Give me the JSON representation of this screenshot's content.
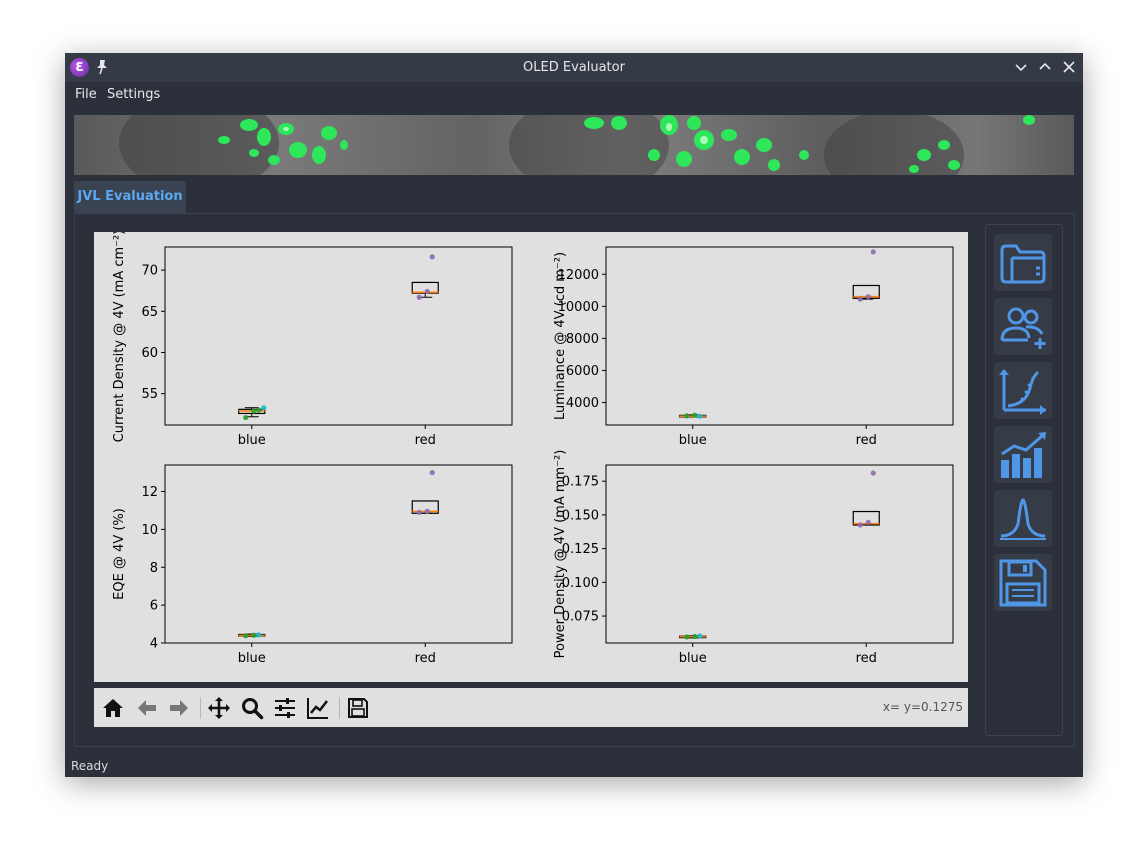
{
  "window": {
    "title": "OLED Evaluator",
    "app_icon_letter": "Ɛ"
  },
  "menu": [
    "File",
    "Settings"
  ],
  "tabs": [
    {
      "label": "JVL Evaluation"
    }
  ],
  "toolbar": {
    "icons": [
      "home-icon",
      "back-icon",
      "forward-icon",
      "pan-icon",
      "zoom-icon",
      "configure-subplots-icon",
      "edit-axis-icon",
      "save-figure-icon"
    ],
    "coords": "x= y=0.1275"
  },
  "side_buttons": [
    "open-folder-icon",
    "add-users-icon",
    "fit-curve-icon",
    "statistics-chart-icon",
    "spectrum-icon",
    "save-icon"
  ],
  "status": "Ready",
  "colors": {
    "accent": "#4f97e6",
    "median": "#ff7f0e",
    "blue_group": "#2ca02c",
    "blue_group_alt": "#17becf",
    "red_group": "#8c6bb1"
  },
  "chart_data": [
    {
      "type": "box",
      "ylabel": "Current Density @ 4V (mA cm⁻²)",
      "categories": [
        "blue",
        "red"
      ],
      "ylim": [
        51.2,
        72.8
      ],
      "yticks": [
        55,
        60,
        65,
        70
      ],
      "boxes": [
        {
          "q1": 52.6,
          "median": 52.9,
          "q3": 53.1,
          "whisker_low": 52.2,
          "whisker_high": 53.3
        },
        {
          "q1": 67.2,
          "median": 67.3,
          "q3": 68.5,
          "whisker_low": 66.7,
          "whisker_high": 68.5
        }
      ],
      "points": [
        {
          "category": "blue",
          "values": [
            52.1,
            52.9,
            53.0,
            53.3
          ]
        },
        {
          "category": "red",
          "values": [
            66.7,
            67.4,
            71.6
          ]
        }
      ]
    },
    {
      "type": "box",
      "ylabel": "Luminance @ 4V (cd m⁻²)",
      "categories": [
        "blue",
        "red"
      ],
      "ylim": [
        2600,
        13700
      ],
      "yticks": [
        4000,
        6000,
        8000,
        10000,
        12000
      ],
      "boxes": [
        {
          "q1": 3120,
          "median": 3150,
          "q3": 3200,
          "whisker_low": 3100,
          "whisker_high": 3230
        },
        {
          "q1": 10500,
          "median": 10600,
          "q3": 11300,
          "whisker_low": 10450,
          "whisker_high": 11300
        }
      ],
      "points": [
        {
          "category": "blue",
          "values": [
            3170,
            3210,
            3150
          ]
        },
        {
          "category": "red",
          "values": [
            10450,
            10600,
            13400
          ]
        }
      ]
    },
    {
      "type": "box",
      "ylabel": "EQE @ 4V (%)",
      "categories": [
        "blue",
        "red"
      ],
      "ylim": [
        4.0,
        13.4
      ],
      "yticks": [
        4,
        6,
        8,
        10,
        12
      ],
      "boxes": [
        {
          "q1": 4.37,
          "median": 4.4,
          "q3": 4.45,
          "whisker_low": 4.35,
          "whisker_high": 4.47
        },
        {
          "q1": 10.85,
          "median": 10.95,
          "q3": 11.5,
          "whisker_low": 10.85,
          "whisker_high": 11.5
        }
      ],
      "points": [
        {
          "category": "blue",
          "values": [
            4.38,
            4.41,
            4.43
          ]
        },
        {
          "category": "red",
          "values": [
            10.9,
            10.95,
            13.0
          ]
        }
      ]
    },
    {
      "type": "box",
      "ylabel": "Power Density @ 4V (mA mm⁻²)",
      "categories": [
        "blue",
        "red"
      ],
      "ylim": [
        0.055,
        0.187
      ],
      "yticks": [
        0.075,
        0.1,
        0.125,
        0.15,
        0.175
      ],
      "ytick_labels": [
        "0.075",
        "0.100",
        "0.125",
        "0.150",
        "0.175"
      ],
      "boxes": [
        {
          "q1": 0.0592,
          "median": 0.0597,
          "q3": 0.0601,
          "whisker_low": 0.0588,
          "whisker_high": 0.0604
        },
        {
          "q1": 0.1425,
          "median": 0.1435,
          "q3": 0.1525,
          "whisker_low": 0.1425,
          "whisker_high": 0.1525
        }
      ],
      "points": [
        {
          "category": "blue",
          "values": [
            0.0595,
            0.0598,
            0.0602
          ]
        },
        {
          "category": "red",
          "values": [
            0.1425,
            0.1445,
            0.181
          ]
        }
      ]
    }
  ]
}
